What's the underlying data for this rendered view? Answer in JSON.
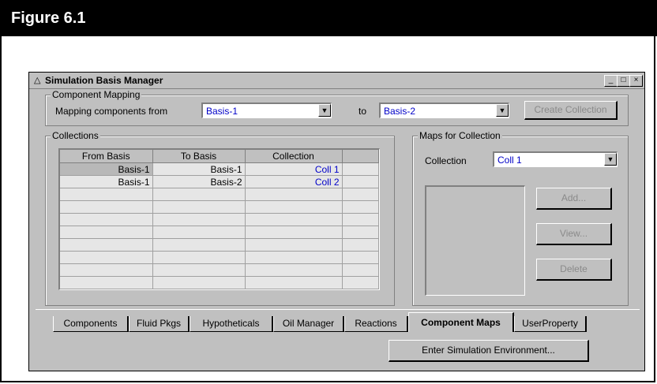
{
  "figure": {
    "title": "Figure 6.1"
  },
  "window": {
    "title": "Simulation Basis Manager",
    "controls": [
      "_",
      "□",
      "×"
    ]
  },
  "component_mapping": {
    "group_label": "Component Mapping",
    "from_label": "Mapping components from",
    "from_value": "Basis-1",
    "to_label": "to",
    "to_value": "Basis-2",
    "create_button": "Create Collection"
  },
  "collections": {
    "group_label": "Collections",
    "columns": [
      "From Basis",
      "To Basis",
      "Collection",
      ""
    ],
    "rows": [
      [
        "Basis-1",
        "Basis-1",
        "Coll 1",
        ""
      ],
      [
        "Basis-1",
        "Basis-2",
        "Coll 2",
        ""
      ],
      [
        "",
        "",
        "",
        ""
      ],
      [
        "",
        "",
        "",
        ""
      ],
      [
        "",
        "",
        "",
        ""
      ],
      [
        "",
        "",
        "",
        ""
      ],
      [
        "",
        "",
        "",
        ""
      ],
      [
        "",
        "",
        "",
        ""
      ],
      [
        "",
        "",
        "",
        ""
      ],
      [
        "",
        "",
        "",
        ""
      ]
    ]
  },
  "maps": {
    "group_label": "Maps for Collection",
    "collection_label": "Collection",
    "collection_value": "Coll 1",
    "add_button": "Add...",
    "view_button": "View...",
    "delete_button": "Delete"
  },
  "tabs": [
    "Components",
    "Fluid Pkgs",
    "Hypotheticals",
    "Oil Manager",
    "Reactions",
    "Component Maps",
    "UserProperty"
  ],
  "active_tab": "Component Maps",
  "enter_button": "Enter Simulation Environment...",
  "colors": {
    "value_text": "#0000c8",
    "face": "#c0c0c0",
    "disabled_text": "#8a8a8a"
  }
}
